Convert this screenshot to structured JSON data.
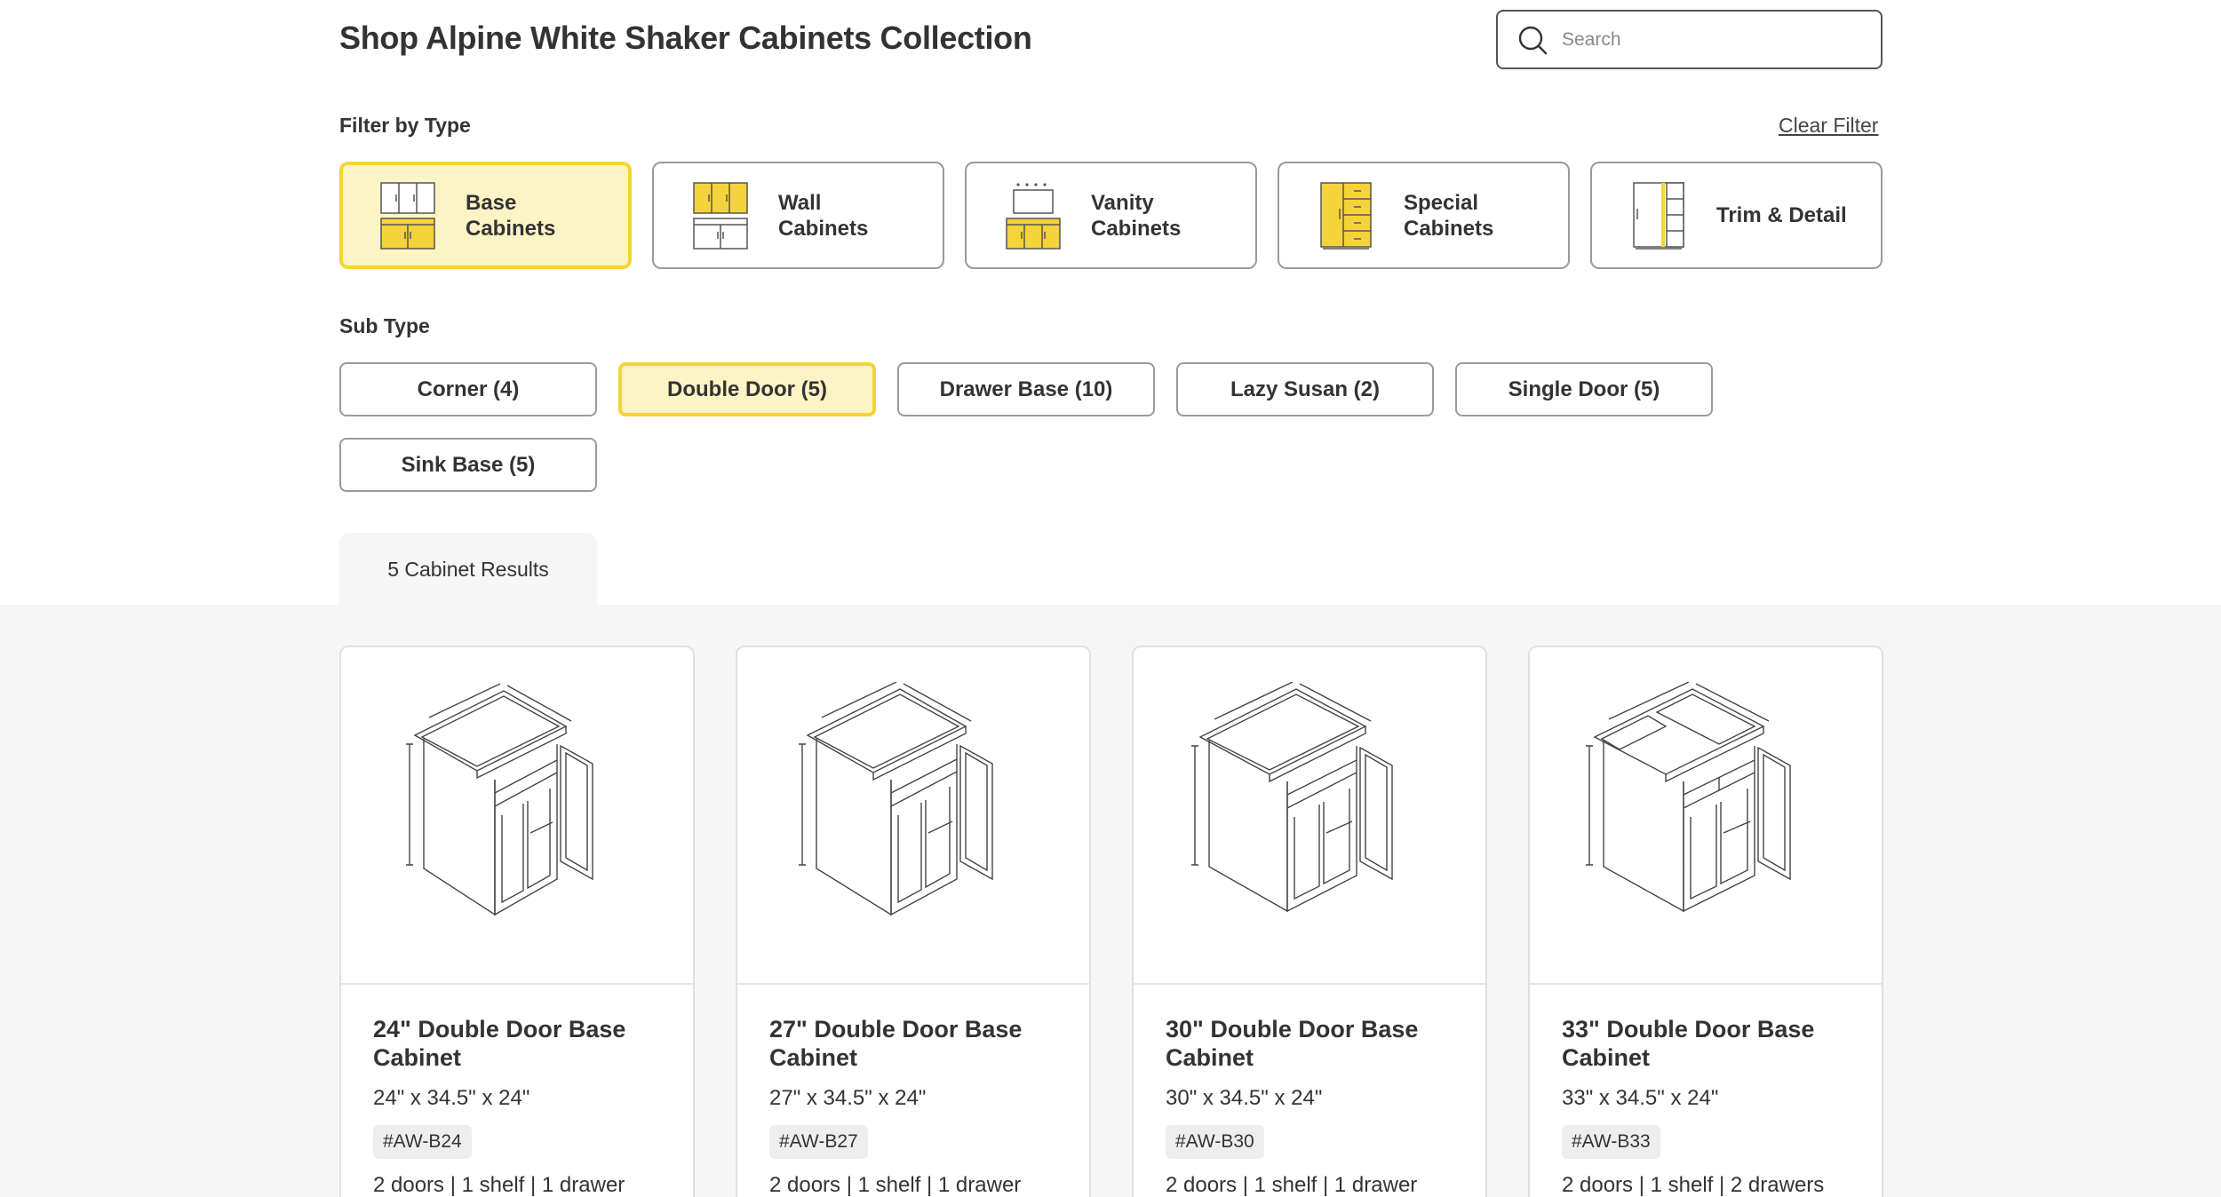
{
  "header": {
    "title": "Shop Alpine White Shaker Cabinets Collection",
    "search_placeholder": "Search"
  },
  "filter": {
    "label": "Filter by Type",
    "clear_label": "Clear Filter",
    "types": [
      {
        "label": "Base\nCabinets",
        "icon": "base-cabinet-icon",
        "active": true
      },
      {
        "label": "Wall\nCabinets",
        "icon": "wall-cabinet-icon",
        "active": false
      },
      {
        "label": "Vanity\nCabinets",
        "icon": "vanity-cabinet-icon",
        "active": false
      },
      {
        "label": "Special\nCabinets",
        "icon": "special-cabinet-icon",
        "active": false
      },
      {
        "label": "Trim & Detail",
        "icon": "trim-detail-icon",
        "active": false
      }
    ]
  },
  "subtype": {
    "label": "Sub Type",
    "items": [
      {
        "label": "Corner (4)",
        "active": false
      },
      {
        "label": "Double Door (5)",
        "active": true
      },
      {
        "label": "Drawer Base (10)",
        "active": false
      },
      {
        "label": "Lazy Susan (2)",
        "active": false
      },
      {
        "label": "Single Door (5)",
        "active": false
      },
      {
        "label": "Sink Base (5)",
        "active": false
      }
    ]
  },
  "results": {
    "label": "5 Cabinet Results",
    "cards": [
      {
        "title": "24\" Double Door Base Cabinet",
        "dims": "24\" x 34.5\" x 24\"",
        "sku": "#AW-B24",
        "desc": "2 doors | 1 shelf | 1 drawer"
      },
      {
        "title": "27\" Double Door Base Cabinet",
        "dims": "27\" x 34.5\" x 24\"",
        "sku": "#AW-B27",
        "desc": "2 doors | 1 shelf | 1 drawer"
      },
      {
        "title": "30\" Double Door Base Cabinet",
        "dims": "30\" x 34.5\" x 24\"",
        "sku": "#AW-B30",
        "desc": "2 doors | 1 shelf | 1 drawer"
      },
      {
        "title": "33\" Double Door Base Cabinet",
        "dims": "33\" x 34.5\" x 24\"",
        "sku": "#AW-B33",
        "desc": "2 doors | 1 shelf | 2 drawers"
      }
    ]
  },
  "colors": {
    "accent": "#f5d33a",
    "accent_bg": "#fdf4c6",
    "panel_bg": "#f6f6f6"
  }
}
